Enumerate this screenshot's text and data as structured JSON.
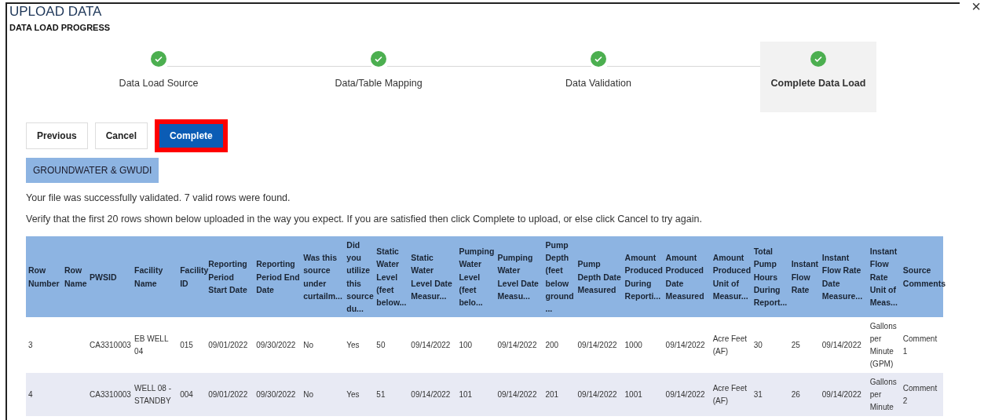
{
  "title": "UPLOAD DATA",
  "subtitle": "DATA LOAD PROGRESS",
  "close": "×",
  "steps": [
    {
      "label": "Data Load Source",
      "completed": true,
      "selected": false
    },
    {
      "label": "Data/Table Mapping",
      "completed": true,
      "selected": false
    },
    {
      "label": "Data Validation",
      "completed": true,
      "selected": false
    },
    {
      "label": "Complete Data Load",
      "completed": true,
      "selected": true
    }
  ],
  "buttons": [
    {
      "label": "Previous",
      "kind": "outline",
      "highlighted": false
    },
    {
      "label": "Cancel",
      "kind": "outline",
      "highlighted": false
    },
    {
      "label": "Complete",
      "kind": "primary",
      "highlighted": true
    }
  ],
  "group_tab": {
    "label": "GROUNDWATER & GWUDI"
  },
  "messages": [
    "Your file was successfully validated. 7 valid rows were found.",
    "Verify that the first 20 rows shown below uploaded in the way you expect. If you are satisfied then click Complete to upload, or else click Cancel to try again."
  ],
  "table": {
    "columns": [
      "Row Number",
      "Row Name",
      "PWSID",
      "Facility Name",
      "Facility ID",
      "Reporting Period Start Date",
      "Reporting Period End Date",
      "Was this source under curtailm...",
      "Did you utilize this source du...",
      "Static Water Level (feet below...",
      "Static Water Level Date Measur...",
      "Pumping Water Level (feet belo...",
      "Pumping Water Level Date Measu...",
      "Pump Depth (feet below ground ...",
      "Pump Depth Date Measured",
      "Amount Produced During Reporti...",
      "Amount Produced Date Measured",
      "Amount Produced Unit of Measur...",
      "Total Pump Hours During Report...",
      "Instant Flow Rate",
      "Instant Flow Rate Date Measure...",
      "Instant Flow Rate Unit of Meas...",
      "Source Comments"
    ],
    "rows": [
      [
        "3",
        "",
        "CA3310003",
        "EB WELL 04",
        "015",
        "09/01/2022",
        "09/30/2022",
        "No",
        "Yes",
        "50",
        "09/14/2022",
        "100",
        "09/14/2022",
        "200",
        "09/14/2022",
        "1000",
        "09/14/2022",
        "Acre Feet (AF)",
        "30",
        "25",
        "09/14/2022",
        "Gallons per Minute (GPM)",
        "Comment 1"
      ],
      [
        "4",
        "",
        "CA3310003",
        "WELL 08 - STANDBY",
        "004",
        "09/01/2022",
        "09/30/2022",
        "No",
        "Yes",
        "51",
        "09/14/2022",
        "101",
        "09/14/2022",
        "201",
        "09/14/2022",
        "1001",
        "09/14/2022",
        "Acre Feet (AF)",
        "31",
        "26",
        "09/14/2022",
        "Gallons per Minute",
        "Comment 2"
      ]
    ]
  }
}
